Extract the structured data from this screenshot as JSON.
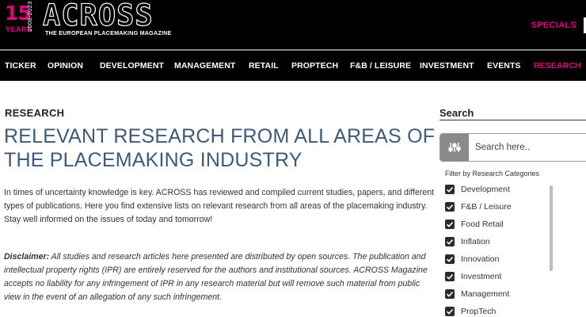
{
  "header": {
    "logo_years_number": "15",
    "logo_years_word": "YEARS",
    "logo_dates": "2008-2023",
    "logo_name": "ACROSS",
    "logo_tagline": "THE EUROPEAN PLACEMAKING MAGAZINE",
    "specials_label": "SPECIALS"
  },
  "nav": {
    "items": [
      "TICKER",
      "OPINION",
      "DEVELOPMENT",
      "MANAGEMENT",
      "RETAIL",
      "PROPTECH",
      "F&B / LEISURE",
      "INVESTMENT",
      "EVENTS",
      "RESEARCH"
    ],
    "active": "RESEARCH",
    "accent_color": "#e6007e"
  },
  "main": {
    "kicker": "RESEARCH",
    "title": "RELEVANT RESEARCH FROM ALL AREAS OF THE PLACEMAKING INDUSTRY",
    "intro": "In times of uncertainty knowledge is key. ACROSS has reviewed and compiled current studies, papers, and different types of publications. Here you find extensive lists on relevant research from all areas of the placemaking industry. Stay well informed on the issues of today and tomorrow!",
    "disclaimer_label": "Disclaimer:",
    "disclaimer_text": " All studies and research articles here presented are distributed by open sources. The publication and intellectual property rights (IPR) are entirely reserved for the authors and institutional sources. ACROSS Magazine accepts no liability for any infringement of IPR in any research material but will remove such material from public view in the event of an allegation of any such infringement."
  },
  "sidebar": {
    "search_title": "Search",
    "search_placeholder": "Search here..",
    "filter_label": "Filter by Research Categories",
    "categories": [
      {
        "label": "Development",
        "checked": true
      },
      {
        "label": "F&B / Leisure",
        "checked": true
      },
      {
        "label": "Food Retail",
        "checked": true
      },
      {
        "label": "Inflation",
        "checked": true
      },
      {
        "label": "Innovation",
        "checked": true
      },
      {
        "label": "Investment",
        "checked": true
      },
      {
        "label": "Management",
        "checked": true
      },
      {
        "label": "PropTech",
        "checked": true
      }
    ]
  }
}
